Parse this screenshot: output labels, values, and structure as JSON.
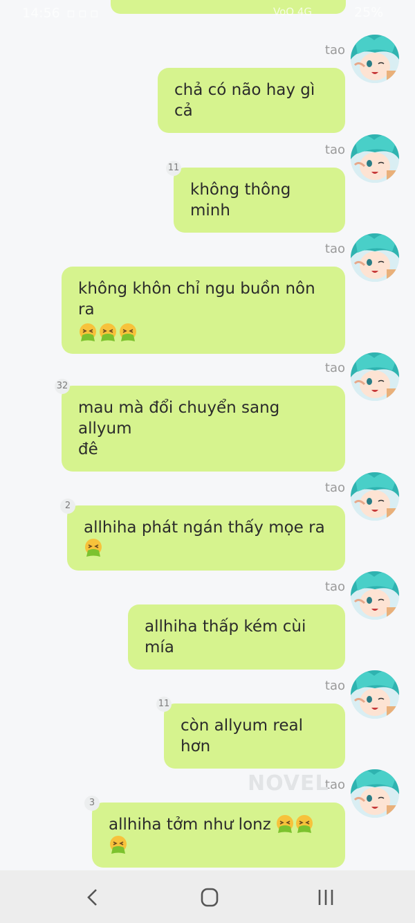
{
  "status_bar": {
    "time": "14:56",
    "network": "VoO 4G",
    "battery": "25%"
  },
  "messages": [
    {
      "sender": "tao",
      "text": "chả có não hay gì cả",
      "count": "",
      "emoji_count": 0,
      "trailing_emoji": false
    },
    {
      "sender": "tao",
      "text": "không thông minh",
      "count": "11",
      "emoji_count": 0,
      "trailing_emoji": false
    },
    {
      "sender": "tao",
      "text": "không khôn chỉ ngu buồn nôn ra",
      "count": "",
      "emoji_count": 3,
      "trailing_emoji": false
    },
    {
      "sender": "tao",
      "text": "mau mà đổi chuyển sang allyum",
      "text_line2": "đê",
      "count": "32",
      "emoji_count": 0,
      "trailing_emoji": false
    },
    {
      "sender": "tao",
      "text": "allhiha phát ngán thấy mọe ra",
      "count": "2",
      "emoji_count": 1,
      "trailing_emoji": true
    },
    {
      "sender": "tao",
      "text": "allhiha thấp kém cùi mía",
      "count": "",
      "emoji_count": 0,
      "trailing_emoji": false
    },
    {
      "sender": "tao",
      "text": "còn allyum real hơn",
      "count": "11",
      "emoji_count": 0,
      "trailing_emoji": false
    },
    {
      "sender": "tao",
      "text": "allhiha tởm như lonz",
      "count": "3",
      "emoji_count": 3,
      "trailing_emoji": true
    }
  ],
  "emoji": "vomiting-face-icon",
  "watermark": "NOVEL",
  "nav": {
    "back": "back-icon",
    "home": "home-icon",
    "recents": "recents-icon"
  },
  "colors": {
    "bubble": "#d6f38e",
    "background": "#f6f7f9",
    "nav_bar": "#ededed"
  }
}
